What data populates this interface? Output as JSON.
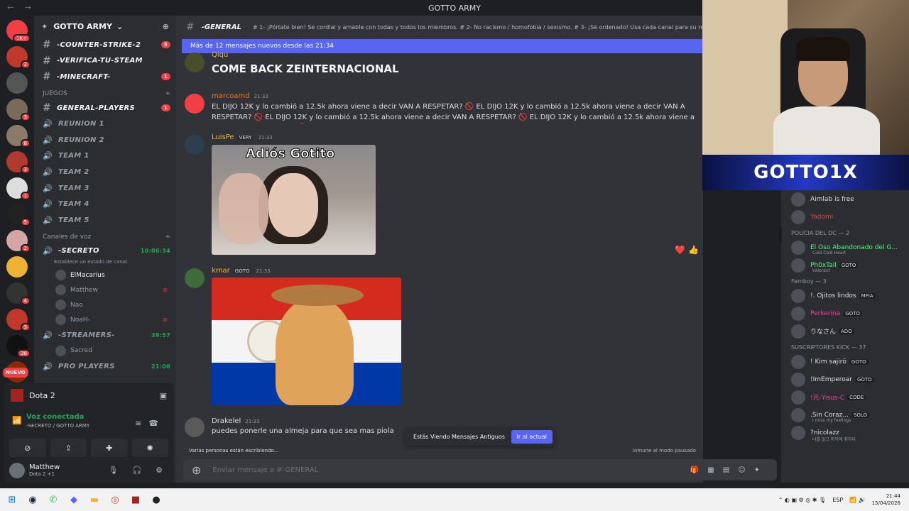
{
  "window": {
    "title": "GOTTO ARMY",
    "nav": "← →"
  },
  "servers": {
    "items": [
      {
        "name": "discord-home",
        "badge": "1K+",
        "color": "#f23f43"
      },
      {
        "name": "server-2",
        "badge": "2",
        "color": "#c0392b"
      },
      {
        "name": "server-3",
        "badge": "",
        "color": "#555"
      },
      {
        "name": "server-4",
        "badge": "3",
        "color": "#7a6a5a"
      },
      {
        "name": "server-5",
        "badge": "8",
        "color": "#8a7a6a"
      },
      {
        "name": "server-6",
        "badge": "3",
        "color": "#b03a2e"
      },
      {
        "name": "server-7",
        "badge": "1",
        "color": "#ddd"
      },
      {
        "name": "server-8",
        "badge": "5",
        "color": "#222"
      },
      {
        "name": "server-9",
        "badge": "2",
        "color": "#d4a5a5"
      },
      {
        "name": "server-10",
        "badge": "",
        "color": "#f0b232"
      },
      {
        "name": "server-11",
        "badge": "4",
        "color": "#333"
      },
      {
        "name": "server-12",
        "badge": "3",
        "color": "#c0392b"
      },
      {
        "name": "server-13",
        "badge": "36",
        "color": "#111"
      },
      {
        "name": "server-14",
        "badge": "",
        "color": "#8a2a0a"
      }
    ],
    "nuevo": "NUEVO"
  },
  "guild": {
    "name": "GOTTO ARMY"
  },
  "channels": {
    "top": [
      {
        "icon": "#",
        "name": "-COUNTER-STRIKE-2",
        "badge": "5"
      },
      {
        "icon": "#",
        "name": "-VERIFICA-TU-STEAM",
        "badge": ""
      },
      {
        "icon": "#",
        "name": "-MINECRAFT-",
        "badge": "1"
      }
    ],
    "juegos_cat": "JUEGOS",
    "juegos": [
      {
        "icon": "#",
        "name": "GENERAL-PLAYERS",
        "badge": "1",
        "kind": "txt"
      },
      {
        "icon": "🔊",
        "name": "REUNION 1",
        "badge": "",
        "kind": "voice"
      },
      {
        "icon": "🔊",
        "name": "REUNION 2",
        "badge": "",
        "kind": "voice"
      },
      {
        "icon": "🔊",
        "name": "TEAM 1",
        "badge": "",
        "kind": "voice"
      },
      {
        "icon": "🔊",
        "name": "TEAM 2",
        "badge": "",
        "kind": "voice"
      },
      {
        "icon": "🔊",
        "name": "TEAM 3",
        "badge": "",
        "kind": "voice"
      },
      {
        "icon": "🔊",
        "name": "TEAM 4",
        "badge": "",
        "kind": "voice"
      },
      {
        "icon": "🔊",
        "name": "TEAM 5",
        "badge": "",
        "kind": "voice"
      }
    ],
    "voz_cat": "Canales de voz",
    "secreto": {
      "name": "-SECRETO",
      "time": "10:06:34",
      "status": "Establece un estado de canal"
    },
    "voice_users": [
      {
        "name": "ElMacarius",
        "active": true
      },
      {
        "name": "Matthew",
        "active": false
      },
      {
        "name": "Nao",
        "active": false
      },
      {
        "name": "NoaH-",
        "active": false
      }
    ],
    "streamers": {
      "name": "-STREAMERS-",
      "time": "39:57"
    },
    "streamer_users": [
      {
        "name": "Sacred"
      }
    ],
    "pro": {
      "name": "PRO PLAYERS",
      "time": "21:06"
    }
  },
  "panel": {
    "activity": "Dota 2",
    "voice_status": "Voz conectada",
    "voice_channel": "-SECRETO / GOTTO ARMY",
    "user_name": "Matthew",
    "user_sub": "Dota 2 +1"
  },
  "chat": {
    "channel": "-GENERAL",
    "topic": "# 1- ¡Pórtate bien! Se cordial y amable con todas y todos los miembros. # 2- No racismo / homofobia / sexismo. # 3- ¡Se ordenado! Usa cada canal para su re...",
    "new_messages": "Más de 12 mensajes nuevos desde las 21:34",
    "messages": [
      {
        "user": "Qiqu",
        "time": "",
        "text": "COME BACK ZEINTERNACIONAL",
        "color": "#f0b232"
      },
      {
        "user": "marcoamd",
        "time": "21:33",
        "text": "EL DIJO 12K y lo cambió a 12.5k ahora viene a decir VAN A RESPETAR? 🚫 EL DIJO 12K y lo cambió a 12.5k ahora viene a decir VAN A RESPETAR? 🚫 EL DIJO 12K y lo cambió a 12.5k ahora viene a decir VAN A RESPETAR? 🚫 EL DIJO 12K y lo cambió a 12.5k ahora viene a decir VAN A RESPETAR? 🚫",
        "color": "#e67e22"
      },
      {
        "user": "LuisPe",
        "tag": "VERY",
        "time": "21:33",
        "image_caption": "Adiós Gotito",
        "color": "#f0b232"
      },
      {
        "user": "kmar",
        "tag": "GOTO",
        "time": "21:33",
        "color": "#f0b232"
      },
      {
        "user": "Drakelel",
        "time": "21:33",
        "text": "puedes ponerle una almeja para que sea mas piola",
        "color": "#dbdee1"
      }
    ],
    "reactions": "❤️ 👍",
    "old_banner": "Estás Viendo Mensajes Antiguos",
    "jump": "Ir al actual",
    "typing": "Varias personas están escribiendo...",
    "paused": "Inmune al modo pausado",
    "placeholder": "Enviar mensaje a #-GENERAL"
  },
  "stream": {
    "logo": "GOTTO1X"
  },
  "members": {
    "top": [
      {
        "name": "Aimlab is free",
        "status": ""
      },
      {
        "name": "Yadomi",
        "status": "",
        "color": "#f23f43"
      }
    ],
    "policia_cat": "POLICIA DEL DC — 2",
    "policia": [
      {
        "name": "El Oso Abandonado del G...",
        "status": "Cold Cold Heart",
        "color": "#57f287"
      },
      {
        "name": "Ph0xTail",
        "tag": "GOTO",
        "status": "Valorant",
        "color": "#57f287"
      }
    ],
    "femboy_cat": "Femboy — 3",
    "femboy": [
      {
        "name": "!. Ojitos lindos",
        "tag": "MFIA"
      },
      {
        "name": "Perkerina",
        "tag": "GOTO",
        "color": "#eb459e"
      },
      {
        "name": "りなさん",
        "tag": "ADO"
      }
    ],
    "kick_cat": "SUSCRIPTORES KICK — 37",
    "kick": [
      {
        "name": "! Kim sajirō",
        "tag": "GOTO"
      },
      {
        "name": "!ImEmperoar",
        "tag": "GOTO"
      },
      {
        "name": "!光-Yisus-C",
        "tag": "CODE",
        "color": "#eb459e"
      },
      {
        "name": ".Sin Coraz...",
        "tag": "SOLO",
        "status": "I miss my feelings"
      },
      {
        "name": "?nicolazz",
        "tag": "",
        "status": "너를 알고 마악에 취하다"
      }
    ]
  },
  "taskbar": {
    "lang": "ESP",
    "time": "21:44",
    "date": "15/04/2026"
  }
}
